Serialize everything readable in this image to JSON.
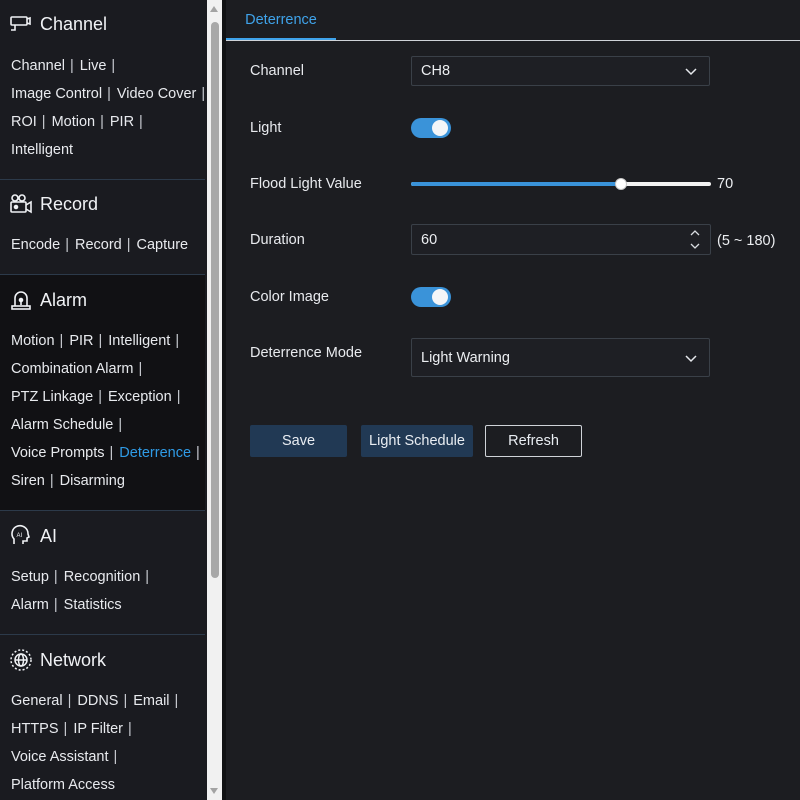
{
  "sidebar": {
    "sections": [
      {
        "key": "channel",
        "title": "Channel",
        "icon": "camera-icon",
        "rows": [
          [
            "Channel",
            "Live"
          ],
          [
            "Image Control",
            "Video Cover"
          ],
          [
            "ROI",
            "Motion",
            "PIR"
          ],
          [
            "Intelligent"
          ]
        ]
      },
      {
        "key": "record",
        "title": "Record",
        "icon": "video-record-icon",
        "rows": [
          [
            "Encode",
            "Record",
            "Capture"
          ]
        ]
      },
      {
        "key": "alarm",
        "title": "Alarm",
        "icon": "alarm-light-icon",
        "rows": [
          [
            "Motion",
            "PIR",
            "Intelligent"
          ],
          [
            "Combination Alarm"
          ],
          [
            "PTZ Linkage",
            "Exception"
          ],
          [
            "Alarm Schedule"
          ],
          [
            "Voice Prompts",
            "Deterrence"
          ],
          [
            "Siren",
            "Disarming"
          ]
        ]
      },
      {
        "key": "ai",
        "title": "AI",
        "icon": "ai-head-icon",
        "rows": [
          [
            "Setup",
            "Recognition"
          ],
          [
            "Alarm",
            "Statistics"
          ]
        ]
      },
      {
        "key": "network",
        "title": "Network",
        "icon": "globe-icon",
        "rows": [
          [
            "General",
            "DDNS",
            "Email"
          ],
          [
            "HTTPS",
            "IP Filter"
          ],
          [
            "Voice Assistant"
          ],
          [
            "Platform Access"
          ]
        ]
      }
    ],
    "active_item": "Deterrence"
  },
  "tabs": [
    {
      "label": "Deterrence",
      "active": true
    }
  ],
  "form": {
    "channel_label": "Channel",
    "channel_value": "CH8",
    "light_label": "Light",
    "light_on": true,
    "flood_label": "Flood Light Value",
    "flood_value": 70,
    "flood_max": 100,
    "duration_label": "Duration",
    "duration_value": "60",
    "duration_range": "(5 ~ 180)",
    "color_label": "Color Image",
    "color_on": true,
    "mode_label": "Deterrence Mode",
    "mode_value": "Light Warning"
  },
  "buttons": {
    "save": "Save",
    "schedule": "Light Schedule",
    "refresh": "Refresh"
  },
  "colors": {
    "accent": "#3fa3ea",
    "toggle_on": "#3a93d9",
    "button_primary": "#213954",
    "background": "#1c1d21"
  }
}
